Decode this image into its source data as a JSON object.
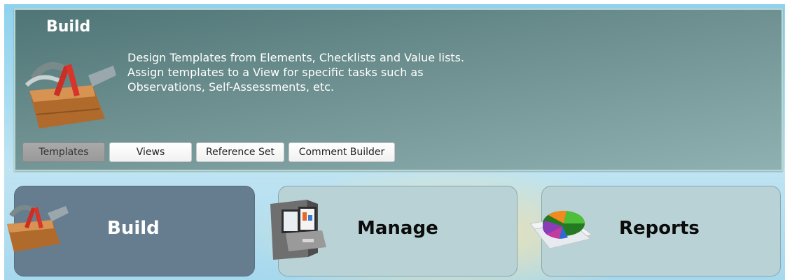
{
  "build_panel": {
    "title": "Build",
    "description_lines": [
      "Design Templates from Elements, Checklists and Value lists.",
      "Assign templates to a View for specific tasks such as",
      "Observations, Self-Assessments, etc."
    ],
    "icon": "toolbox-icon"
  },
  "subtabs": [
    {
      "label": "Templates",
      "active": true
    },
    {
      "label": "Views",
      "active": false
    },
    {
      "label": "Reference Set",
      "active": false
    },
    {
      "label": "Comment Builder",
      "active": false
    }
  ],
  "tiles": [
    {
      "label": "Build",
      "icon": "toolbox-icon",
      "active": true
    },
    {
      "label": "Manage",
      "icon": "file-cabinet-icon",
      "active": false
    },
    {
      "label": "Reports",
      "icon": "pie-chart-icon",
      "active": false
    }
  ],
  "colors": {
    "panel_bg": "#5f8282",
    "active_tile": "#657d8f",
    "inactive_tile": "#b8d2d6",
    "active_tab": "#a3a3a3"
  }
}
